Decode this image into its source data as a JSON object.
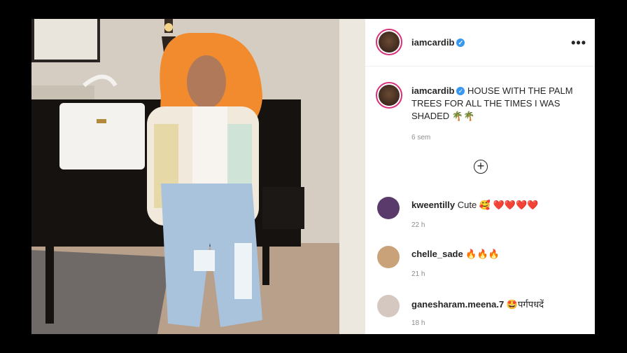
{
  "post": {
    "author": "iamcardib",
    "verified_mark": "✓",
    "more_label": "•••",
    "caption_text": "HOUSE WITH THE PALM TREES FOR ALL THE TIMES I WAS SHADED",
    "caption_emoji": "🌴🌴",
    "posted_ago": "6 sem",
    "load_more_label": "+"
  },
  "comments": [
    {
      "user": "kweentilly",
      "text": "Cute 🥰 ❤️❤️❤️❤️",
      "ago": "22 h",
      "avatar_color": "#5a3a6a"
    },
    {
      "user": "chelle_sade",
      "text": "🔥🔥🔥",
      "ago": "21 h",
      "avatar_color": "#c9a27a"
    },
    {
      "user": "ganesharam.meena.7",
      "text": "🤩पर्गपधदें",
      "ago": "18 h",
      "avatar_color": "#d4c8c0"
    }
  ],
  "colors": {
    "verified": "#3897f0",
    "story_ring": "#d8307a",
    "hair": "#f28a2e"
  },
  "icons": [
    "verified-badge-icon",
    "more-options-icon",
    "load-more-comments-icon"
  ]
}
